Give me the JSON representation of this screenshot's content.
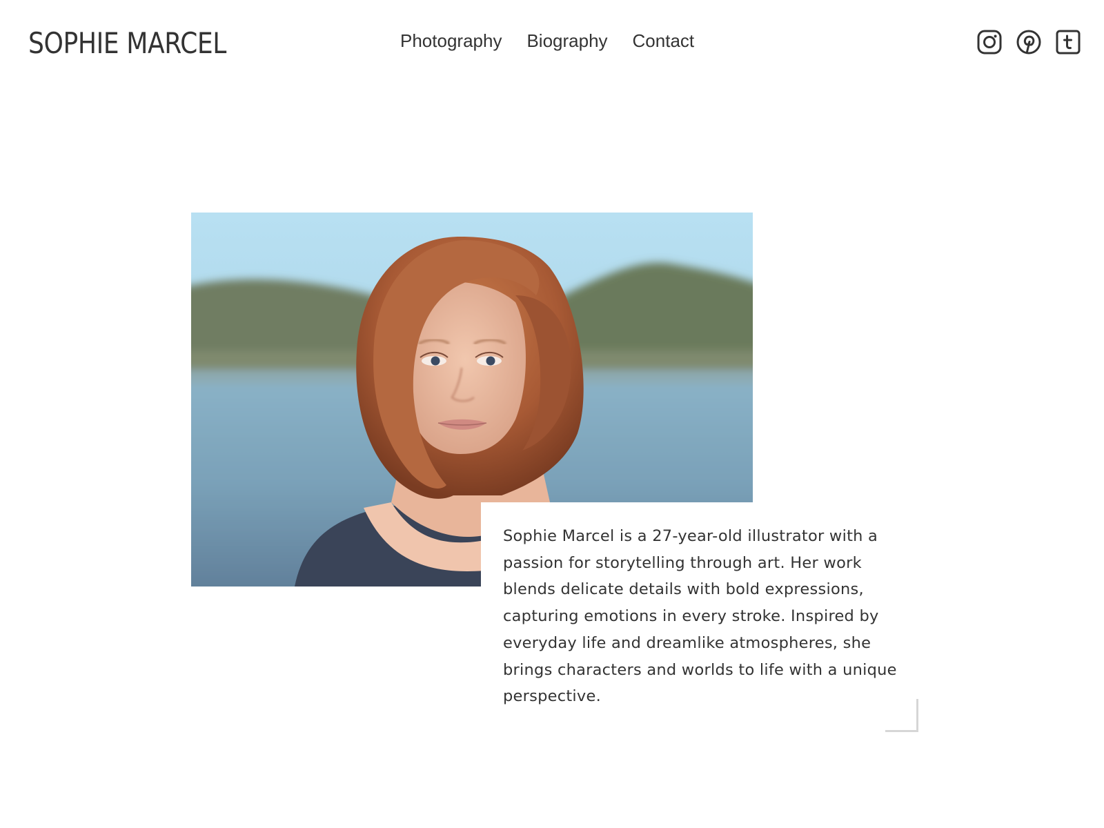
{
  "header": {
    "logo": "SOPHIE MARCEL",
    "nav": [
      {
        "label": "Photography"
      },
      {
        "label": "Biography"
      },
      {
        "label": "Contact"
      }
    ],
    "social": [
      {
        "icon": "instagram-icon"
      },
      {
        "icon": "pinterest-icon"
      },
      {
        "icon": "tumblr-icon"
      }
    ]
  },
  "bio": {
    "text": "Sophie Marcel is a 27-year-old illustrator with a passion for storytelling through art. Her work blends delicate details with bold expressions, capturing emotions in every stroke. Inspired by everyday life and dreamlike atmospheres, she brings characters and worlds to life with a unique perspective."
  },
  "colors": {
    "text": "#333333",
    "background": "#ffffff",
    "accent_line": "#d6d6d6"
  }
}
